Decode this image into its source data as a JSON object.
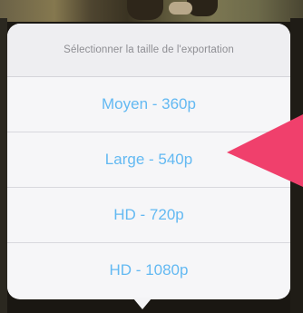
{
  "popover": {
    "title": "Sélectionner la taille de l'exportation",
    "options": [
      {
        "label": "Moyen - 360p"
      },
      {
        "label": "Large - 540p"
      },
      {
        "label": "HD - 720p"
      },
      {
        "label": "HD - 1080p"
      }
    ]
  },
  "colors": {
    "option_text": "#63b9f2",
    "header_text": "#8e8e93",
    "annotation_arrow": "#f0406c"
  }
}
